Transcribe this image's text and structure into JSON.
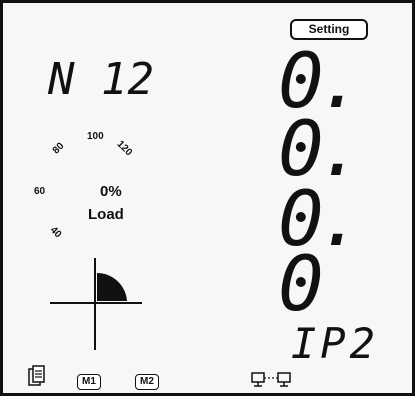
{
  "header": {
    "setting_label": "Setting"
  },
  "channel": {
    "name": "N 12"
  },
  "load": {
    "percent_text": "0%",
    "label": "Load",
    "gauge_ticks": [
      "60",
      "80",
      "100",
      "120",
      "40"
    ]
  },
  "readout": {
    "digits": [
      "0.",
      "0.",
      "0.",
      "0"
    ],
    "code": "IP2"
  },
  "footer": {
    "m1_label": "M1",
    "m2_label": "M2"
  },
  "icons": [
    "clipboard-icon",
    "monitor-link-icon",
    "quadrant-icon"
  ]
}
